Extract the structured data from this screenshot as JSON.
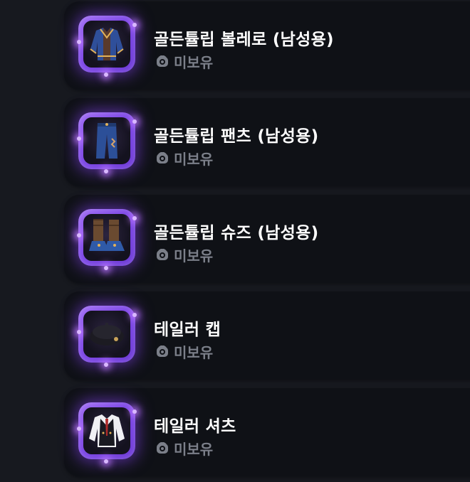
{
  "items": [
    {
      "name": "골든튤립 볼레로 (남성용)",
      "status": "미보유",
      "icon": "bolero-jacket-icon"
    },
    {
      "name": "골든튤립 팬츠 (남성용)",
      "status": "미보유",
      "icon": "pants-icon"
    },
    {
      "name": "골든튤립 슈즈 (남성용)",
      "status": "미보유",
      "icon": "boots-icon"
    },
    {
      "name": "테일러 캡",
      "status": "미보유",
      "icon": "beret-cap-icon"
    },
    {
      "name": "테일러 셔츠",
      "status": "미보유",
      "icon": "shirt-vest-icon"
    }
  ],
  "colors": {
    "background": "#17191f",
    "card": "#0f1116",
    "frame_accent": "#8a52ee",
    "name_text": "#ffffff",
    "status_text": "#7b7f89"
  }
}
